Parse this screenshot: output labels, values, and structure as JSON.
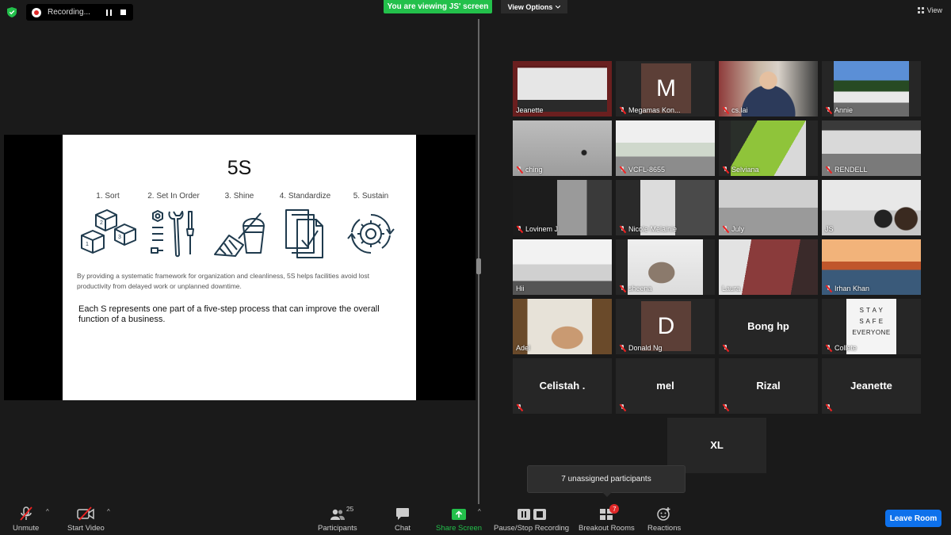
{
  "topbar": {
    "recording_text": "Recording...",
    "viewing_banner": "You are viewing JS' screen",
    "view_options": "View Options",
    "view_label": "View"
  },
  "slide": {
    "title": "5S",
    "steps": [
      "1. Sort",
      "2. Set In Order",
      "3. Shine",
      "4. Standardize",
      "5. Sustain"
    ],
    "description": "By providing a systematic framework for organization and cleanliness, 5S helps facilities avoid lost productivity from delayed work or unplanned downtime.",
    "body": "Each S represents one part of a five-step process that can improve the overall function of a business."
  },
  "participants": [
    {
      "name": "Jeanette",
      "type": "video",
      "muted": false
    },
    {
      "name": "Megamas Kon...",
      "type": "avatar",
      "initial": "M",
      "muted": true
    },
    {
      "name": "cs.lai",
      "type": "video",
      "muted": true
    },
    {
      "name": "Annie",
      "type": "video",
      "muted": true
    },
    {
      "name": "ching",
      "type": "video",
      "muted": true
    },
    {
      "name": "VCFL-8655",
      "type": "video",
      "muted": true
    },
    {
      "name": "Selviana",
      "type": "video",
      "muted": true
    },
    {
      "name": "RENDELL",
      "type": "video",
      "muted": true
    },
    {
      "name": "Lovinem J",
      "type": "video",
      "muted": true
    },
    {
      "name": "Nicole Melainie",
      "type": "video",
      "muted": true
    },
    {
      "name": "July",
      "type": "video",
      "muted": true
    },
    {
      "name": "JS",
      "type": "video",
      "muted": false,
      "active": true
    },
    {
      "name": "Hii",
      "type": "video",
      "muted": false
    },
    {
      "name": "sheena",
      "type": "video",
      "muted": true
    },
    {
      "name": "Laura",
      "type": "video",
      "muted": false
    },
    {
      "name": "Irhan Khan",
      "type": "video",
      "muted": true
    },
    {
      "name": "Adel",
      "type": "video",
      "muted": false
    },
    {
      "name": "Donald Ng",
      "type": "avatar",
      "initial": "D",
      "muted": true
    },
    {
      "name": "Bong hp",
      "type": "name",
      "muted": true
    },
    {
      "name": "Collete",
      "type": "video",
      "muted": true
    },
    {
      "name": "Celistah .",
      "type": "name",
      "muted": true
    },
    {
      "name": "mel",
      "type": "name",
      "muted": true
    },
    {
      "name": "Rizal",
      "type": "name",
      "muted": true
    },
    {
      "name": "Jeanette",
      "type": "name",
      "muted": true
    }
  ],
  "extra_tile": {
    "name": "XL"
  },
  "stay_safe": [
    "S T A Y",
    "S A F E",
    "EVERYONE"
  ],
  "toast": "7 unassigned participants",
  "toolbar": {
    "unmute": "Unmute",
    "start_video": "Start Video",
    "participants": "Participants",
    "participants_count": "25",
    "chat": "Chat",
    "share_screen": "Share Screen",
    "pause_stop_recording": "Pause/Stop Recording",
    "breakout_rooms": "Breakout Rooms",
    "breakout_badge": "7",
    "reactions": "Reactions",
    "leave_room": "Leave Room"
  },
  "colors": {
    "share_green": "#23c04b",
    "leave_blue": "#0e71eb",
    "active_speaker": "#d8e33c",
    "muted_red": "#e22222"
  }
}
